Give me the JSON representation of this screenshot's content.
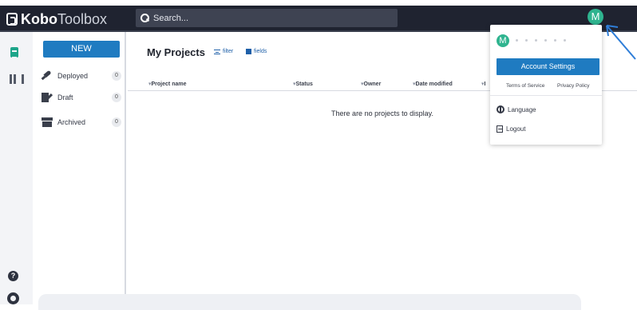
{
  "header": {
    "logo_bold": "Kobo",
    "logo_light": "Toolbox",
    "search_placeholder": "Search...",
    "avatar_letter": "M"
  },
  "sidebar": {
    "new_button": "NEW",
    "items": [
      {
        "label": "Deployed",
        "count": "0",
        "icon": "rocket-icon"
      },
      {
        "label": "Draft",
        "count": "0",
        "icon": "draft-icon"
      },
      {
        "label": "Archived",
        "count": "0",
        "icon": "archive-icon"
      }
    ]
  },
  "main": {
    "title": "My Projects",
    "filter_label": "filter",
    "fields_label": "fields",
    "columns": [
      "Project name",
      "Status",
      "Owner",
      "Date modified",
      "I"
    ],
    "empty_message": "There are no projects to display."
  },
  "rail": {
    "help_glyph": "?"
  },
  "account_menu": {
    "avatar_letter": "M",
    "settings_button": "Account Settings",
    "terms_link": "Terms of Service",
    "privacy_link": "Privacy Policy",
    "language_item": "Language",
    "logout_item": "Logout"
  },
  "colors": {
    "topbar": "#1f2330",
    "accent_blue": "#1f7bc1",
    "avatar_green": "#2fb48f",
    "arrow_blue": "#2f7ed8"
  }
}
